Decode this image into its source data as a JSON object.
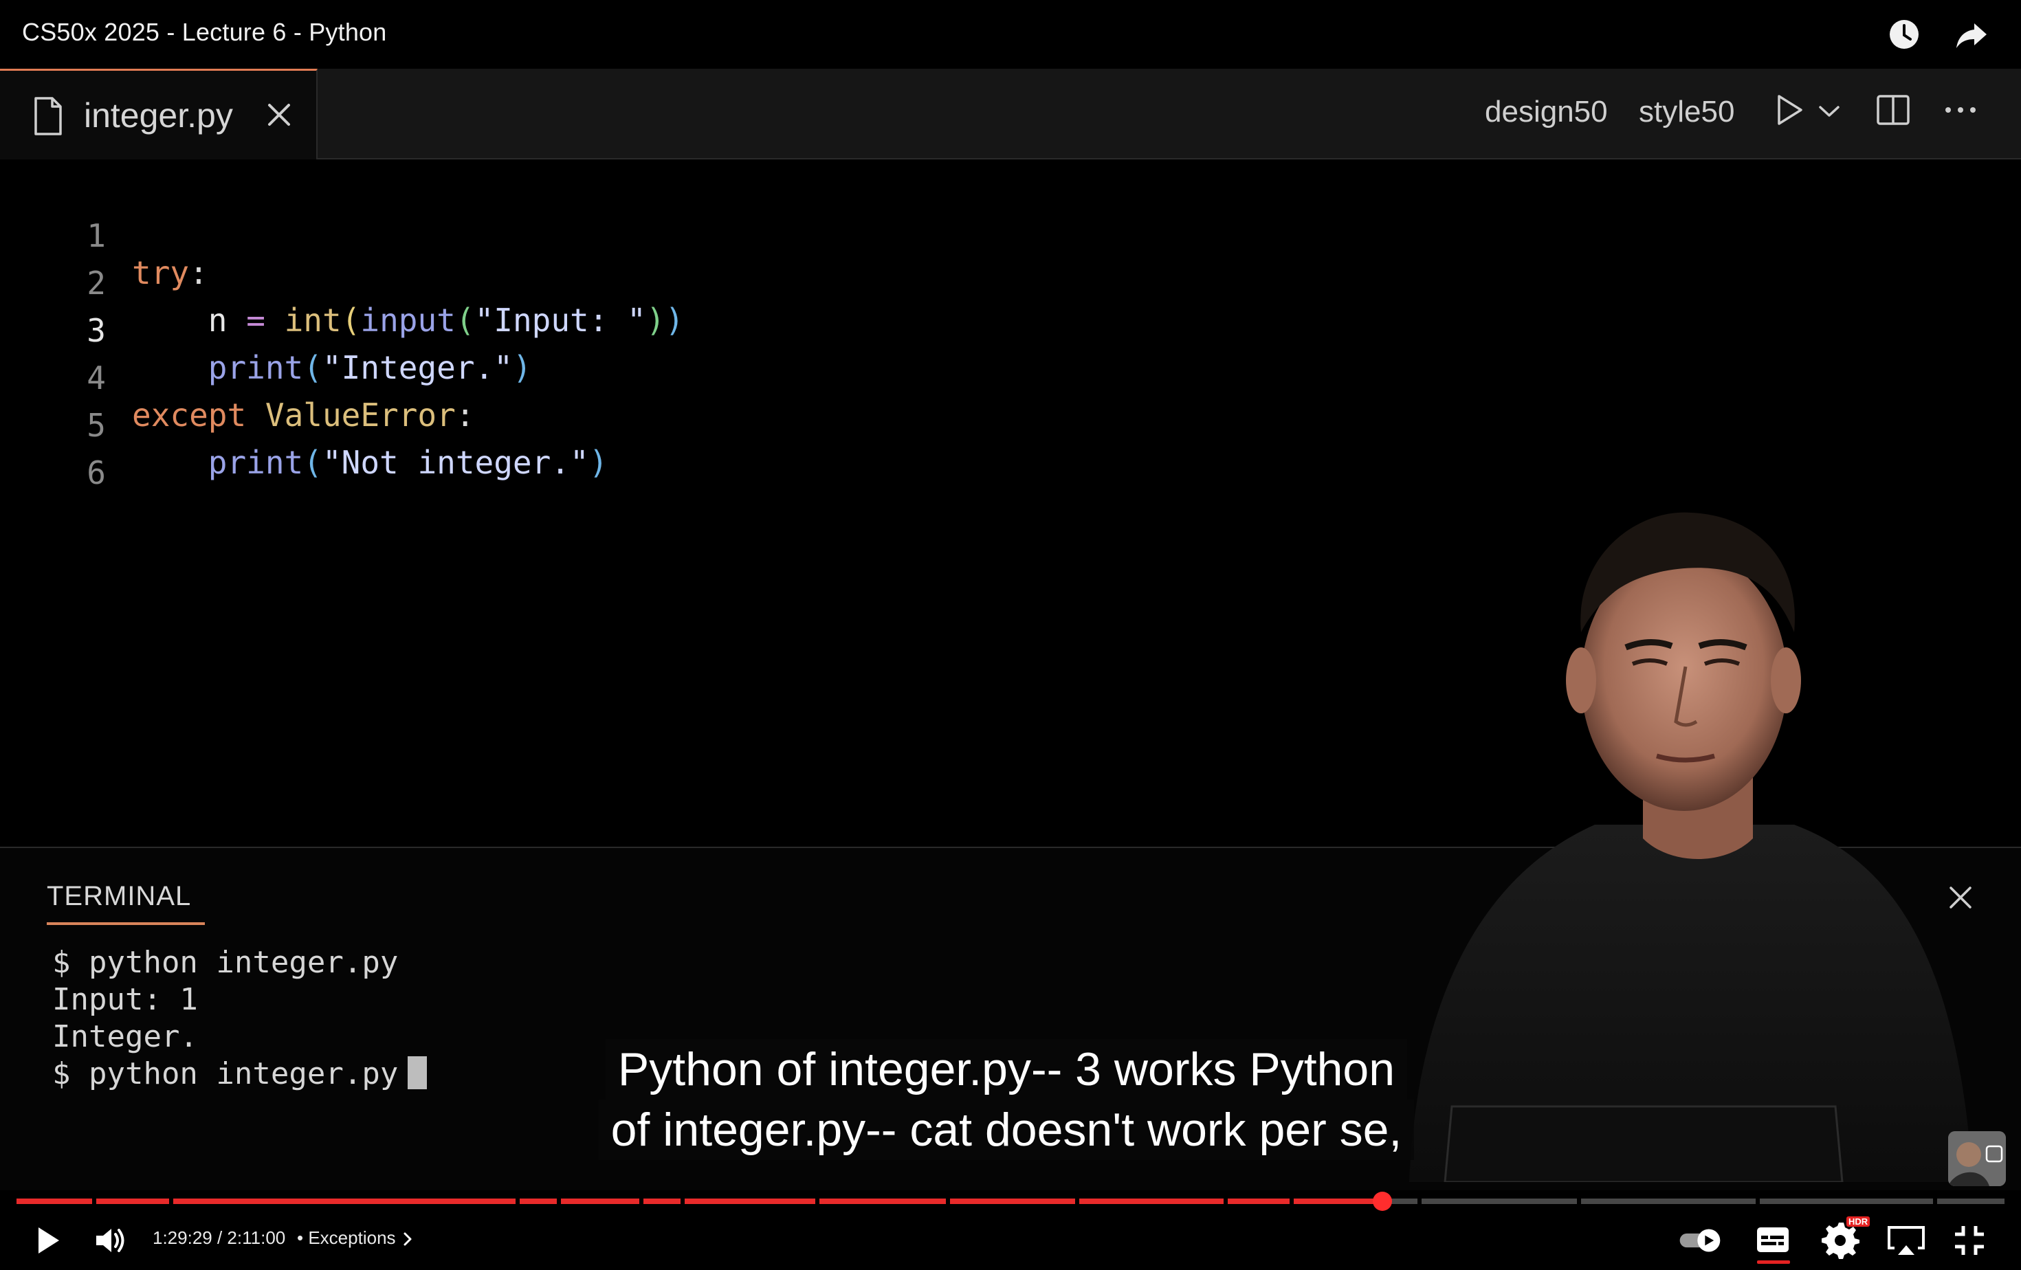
{
  "player": {
    "video_title": "CS50x 2025 - Lecture 6 - Python",
    "current_time": "1:29:29",
    "time_separator": " / ",
    "duration": "2:11:00",
    "chapter_prefix": "•",
    "chapter": "Exceptions",
    "progress_fraction": 0.687,
    "hdr_badge": "HDR",
    "icons": [
      "watch-later-icon",
      "share-icon",
      "play-icon",
      "volume-icon",
      "chevron-right-icon",
      "autoplay-toggle-icon",
      "captions-icon",
      "settings-icon",
      "airplay-icon",
      "exit-fullscreen-icon"
    ],
    "colors": {
      "progress": "#e82a2a",
      "scrubber": "#ff2d2d"
    }
  },
  "editor": {
    "tab_label": "integer.py",
    "actions": {
      "design": "design50",
      "style": "style50"
    },
    "active_line": 3,
    "line_numbers": [
      "1",
      "2",
      "3",
      "4",
      "5",
      "6"
    ],
    "code": {
      "l1_kw": "try",
      "l1_colon": ":",
      "l2_var": "n",
      "l2_eq": "=",
      "l2_int": "int",
      "l2_input": "input",
      "l2_str": "\"Input: \"",
      "l3_print": "print",
      "l3_str": "\"Integer.\"",
      "l4_kw": "except",
      "l4_exc": "ValueError",
      "l4_colon": ":",
      "l5_print": "print",
      "l5_str": "\"Not integer.\""
    }
  },
  "terminal": {
    "tab_label": "TERMINAL",
    "lines": [
      "$ python integer.py",
      "Input: 1",
      "Integer.",
      "$ python integer.py"
    ]
  },
  "captions": {
    "line1": "Python of integer.py-- 3 works Python",
    "line2": "of integer.py-- cat doesn't work per se,"
  }
}
